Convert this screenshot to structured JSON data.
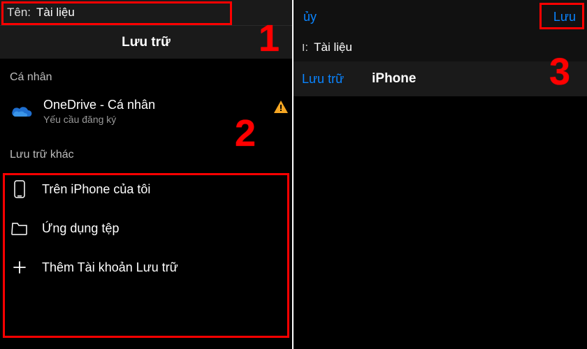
{
  "left": {
    "name_label": "Tên:",
    "name_value": "Tài liệu",
    "storage_title": "Lưu trữ",
    "personal_header": "Cá nhân",
    "onedrive": {
      "title": "OneDrive - Cá nhân",
      "subtitle": "Yếu cầu đăng ký"
    },
    "other_header": "Lưu trữ khác",
    "options": [
      {
        "label": "Trên iPhone của tôi"
      },
      {
        "label": "Ứng dụng tệp"
      },
      {
        "label": "Thêm Tài khoản Lưu trữ"
      }
    ]
  },
  "right": {
    "cancel": "ủy",
    "save": "Lưu",
    "name_label": "ו:",
    "name_value": "Tài liệu",
    "breadcrumb_back": "Lưu trữ",
    "breadcrumb_current": "iPhone"
  },
  "annotations": {
    "n1": "1",
    "n2": "2",
    "n3": "3"
  }
}
